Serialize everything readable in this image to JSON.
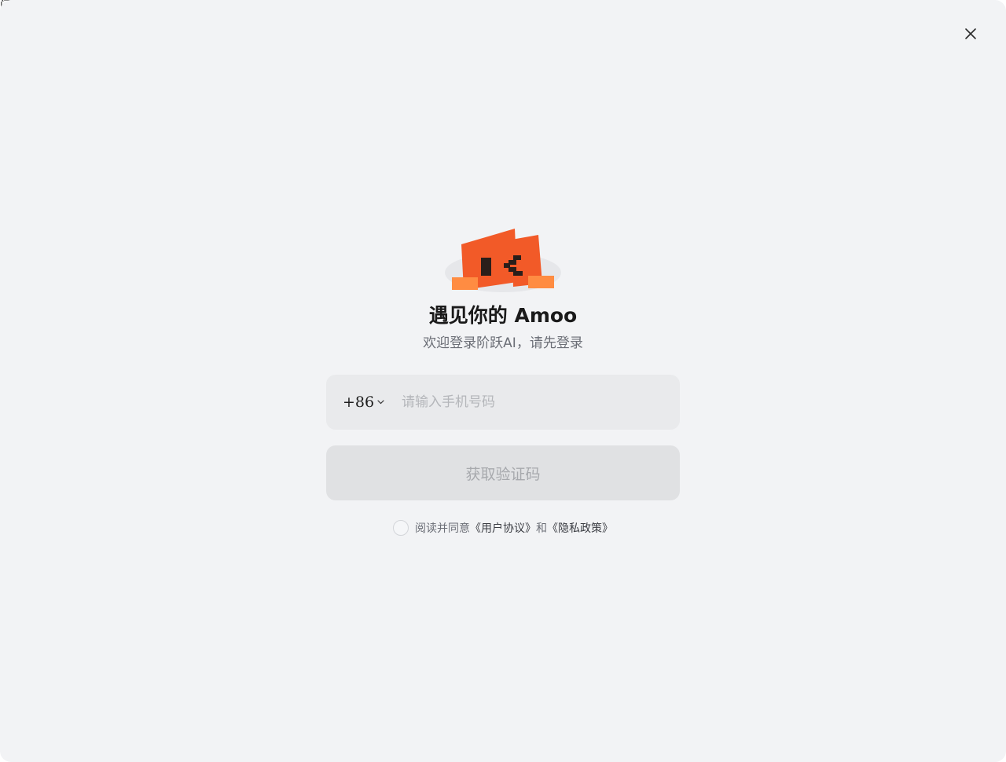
{
  "corner_text": "门",
  "modal": {
    "close_icon": "close-icon",
    "mascot_icon": "orange-block-mascot-icon",
    "title": "遇见你的 Amoo",
    "subtitle": "欢迎登录阶跃AI，请先登录"
  },
  "phone": {
    "country_code": "+86",
    "chevron_icon": "chevron-down-icon",
    "placeholder": "请输入手机号码",
    "value": ""
  },
  "get_code_button": "获取验证码",
  "agreement": {
    "prefix": "阅读并同意",
    "user_agreement": "《用户协议》",
    "connector": "和",
    "privacy_policy": "《隐私政策》",
    "checked": false
  },
  "colors": {
    "mascot_orange": "#f25a28",
    "mascot_light": "#ff8c42",
    "background": "#f2f3f5"
  }
}
